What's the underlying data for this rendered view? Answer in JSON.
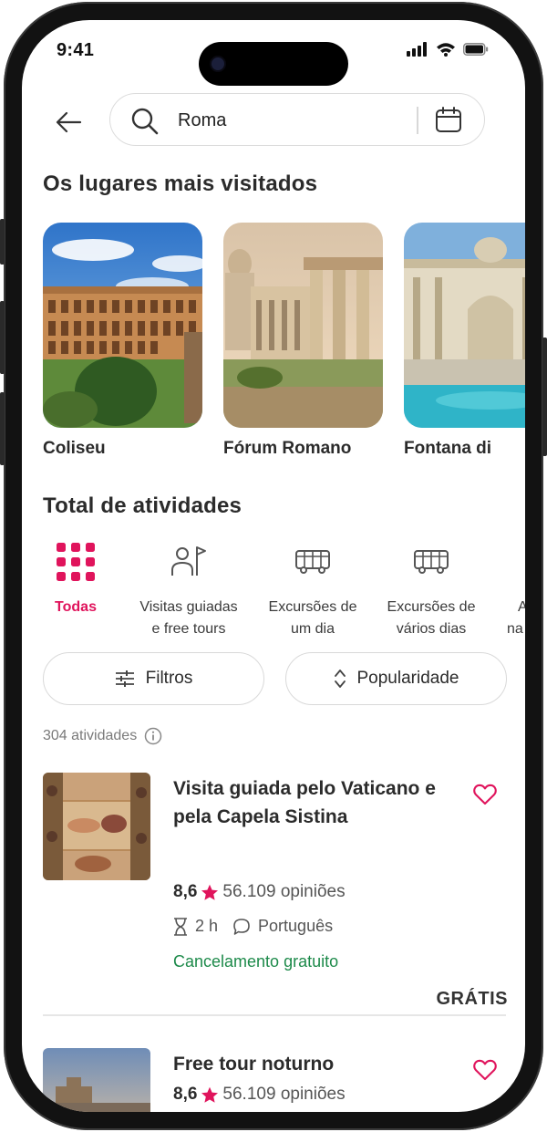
{
  "status": {
    "time": "9:41"
  },
  "search": {
    "query": "Roma"
  },
  "popular": {
    "title": "Os lugares mais visitados",
    "places": [
      {
        "name": "Coliseu"
      },
      {
        "name": "Fórum Romano"
      },
      {
        "name": "Fontana di"
      }
    ]
  },
  "activities_section": {
    "title": "Total de atividades",
    "categories": [
      {
        "line1": "Todas",
        "line2": "",
        "icon": "grid-icon",
        "active": true
      },
      {
        "line1": "Visitas guiadas",
        "line2": "e free tours",
        "icon": "guide-flag-icon",
        "active": false
      },
      {
        "line1": "Excursões de",
        "line2": "um dia",
        "icon": "bus-icon",
        "active": false
      },
      {
        "line1": "Excursões de",
        "line2": "vários dias",
        "icon": "bus-icon",
        "active": false
      },
      {
        "line1": "A",
        "line2": "na",
        "icon": "",
        "active": false
      }
    ]
  },
  "filters": {
    "filter_label": "Filtros",
    "sort_label": "Popularidade"
  },
  "results": {
    "count_label": "304 atividades"
  },
  "activities": [
    {
      "title": "Visita guiada pelo Vaticano e pela Capela Sistina",
      "rating": "8,6",
      "reviews": "56.109 opiniões",
      "duration": "2 h",
      "language": "Português",
      "cancellation": "Cancelamento gratuito",
      "price": "GRÁTIS"
    },
    {
      "title": "Free tour noturno",
      "rating": "8,6",
      "reviews": "56.109 opiniões"
    }
  ],
  "colors": {
    "accent": "#e0145c",
    "green": "#1d8a4a",
    "text": "#2b2b2b"
  }
}
